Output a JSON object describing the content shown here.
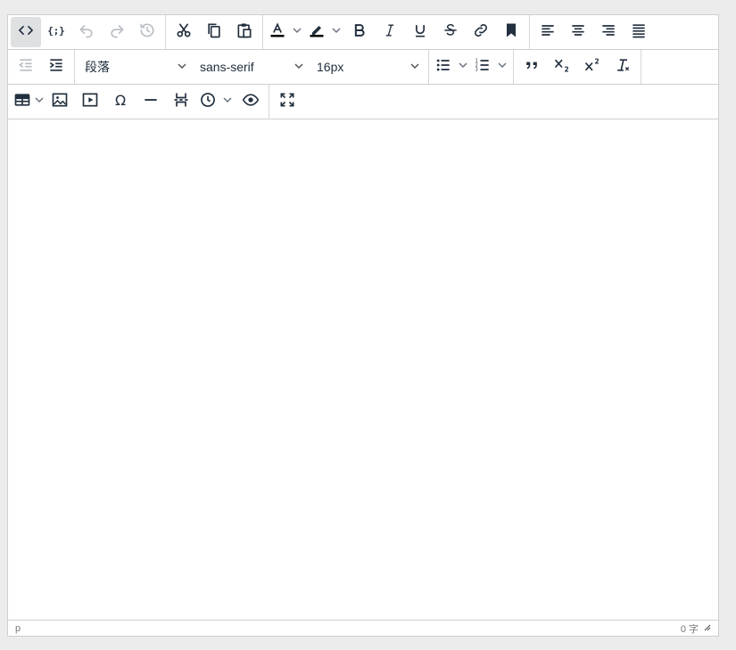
{
  "toolbar": {
    "font_block": "段落",
    "font_family": "sans-serif",
    "font_size": "16px"
  },
  "statusbar": {
    "path": "p",
    "word_count": "0 字"
  },
  "icons": [
    "code-icon",
    "template-icon",
    "undo-icon",
    "redo-icon",
    "restore-draft-icon",
    "cut-icon",
    "copy-icon",
    "paste-icon",
    "text-color-icon",
    "highlight-icon",
    "bold-icon",
    "italic-icon",
    "underline-icon",
    "strikethrough-icon",
    "link-icon",
    "bookmark-icon",
    "align-left-icon",
    "align-center-icon",
    "align-right-icon",
    "align-justify-icon",
    "outdent-icon",
    "indent-icon",
    "bullet-list-icon",
    "numbered-list-icon",
    "blockquote-icon",
    "subscript-icon",
    "superscript-icon",
    "remove-format-icon",
    "table-icon",
    "image-icon",
    "media-icon",
    "special-char-icon",
    "horizontal-rule-icon",
    "page-break-icon",
    "datetime-icon",
    "preview-icon",
    "fullscreen-icon"
  ]
}
